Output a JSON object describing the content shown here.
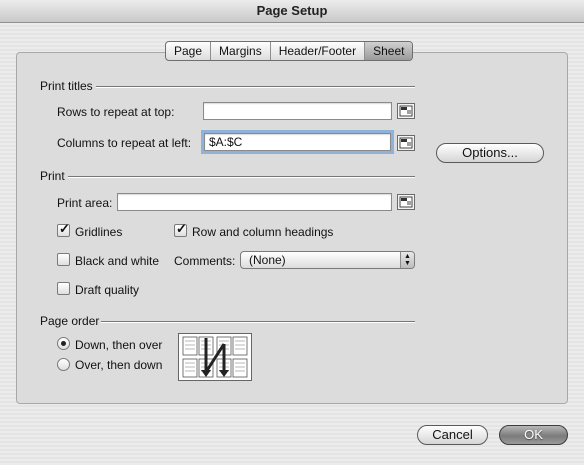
{
  "window": {
    "title": "Page Setup"
  },
  "tabs": [
    {
      "label": "Page"
    },
    {
      "label": "Margins"
    },
    {
      "label": "Header/Footer"
    },
    {
      "label": "Sheet",
      "active": true
    }
  ],
  "print_titles": {
    "heading": "Print titles",
    "rows_label": "Rows to repeat at top:",
    "rows_value": "",
    "columns_label": "Columns to repeat at left:",
    "columns_value": "$A:$C"
  },
  "options_button": "Options...",
  "print": {
    "heading": "Print",
    "area_label": "Print area:",
    "area_value": "",
    "gridlines": {
      "label": "Gridlines",
      "checked": true
    },
    "row_col_headings": {
      "label": "Row and column headings",
      "checked": true
    },
    "black_white": {
      "label": "Black and white",
      "checked": false
    },
    "draft_quality": {
      "label": "Draft quality",
      "checked": false
    },
    "comments_label": "Comments:",
    "comments_value": "(None)"
  },
  "page_order": {
    "heading": "Page order",
    "down_then_over": {
      "label": "Down, then over",
      "selected": true
    },
    "over_then_down": {
      "label": "Over, then down",
      "selected": false
    }
  },
  "footer": {
    "cancel": "Cancel",
    "ok": "OK"
  },
  "icons": {
    "collapse": "collapse-dialog-icon",
    "page_order": "page-order-diagram-icon"
  }
}
